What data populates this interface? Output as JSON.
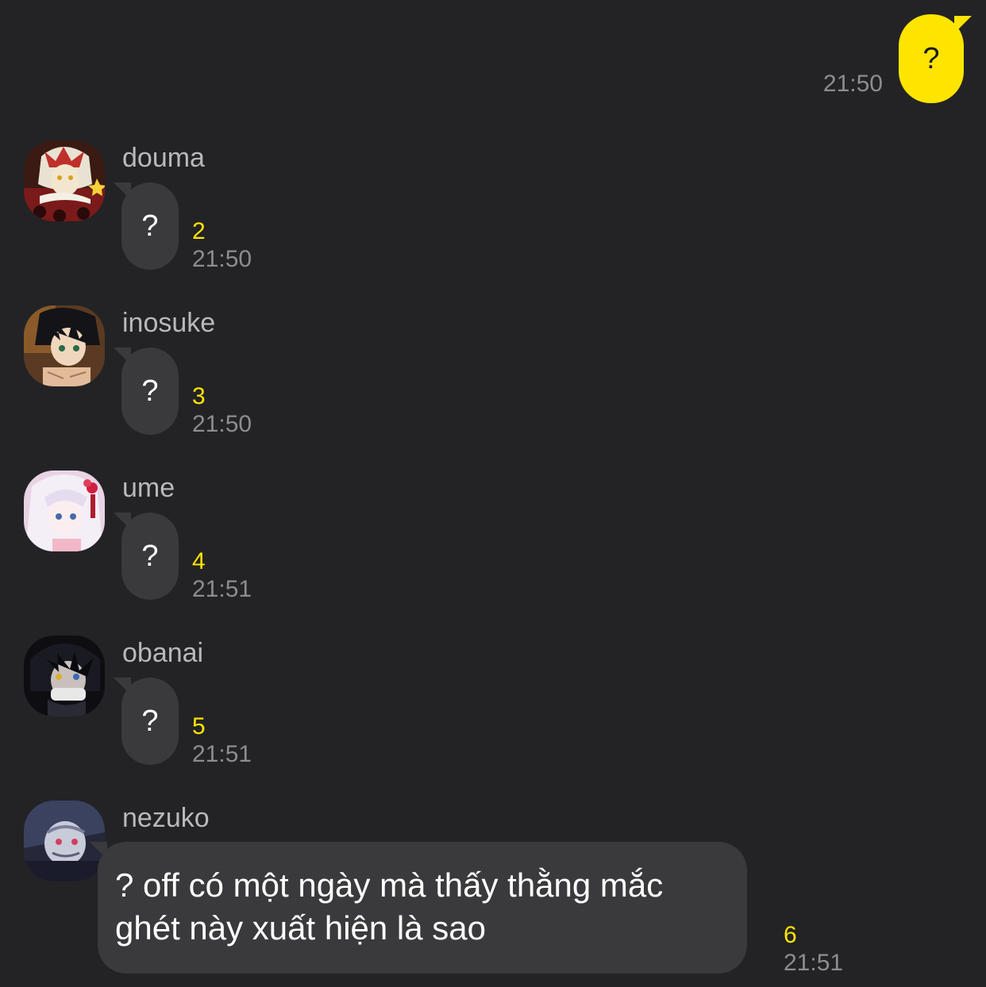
{
  "theme": {
    "background": "#232325",
    "outgoing_bubble": "#fee500",
    "incoming_bubble": "#3a3a3c",
    "unread_color": "#fee500",
    "time_color": "#8d8d90"
  },
  "outgoing": [
    {
      "text": "?",
      "time": "21:50"
    }
  ],
  "messages": [
    {
      "sender": "douma",
      "avatar": "douma-avatar",
      "text": "?",
      "unread": "2",
      "time": "21:50"
    },
    {
      "sender": "inosuke",
      "avatar": "inosuke-avatar",
      "text": "?",
      "unread": "3",
      "time": "21:50"
    },
    {
      "sender": "ume",
      "avatar": "ume-avatar",
      "text": "?",
      "unread": "4",
      "time": "21:51"
    },
    {
      "sender": "obanai",
      "avatar": "obanai-avatar",
      "text": "?",
      "unread": "5",
      "time": "21:51"
    },
    {
      "sender": "nezuko",
      "avatar": "nezuko-avatar",
      "text_line1": "? off có một ngày mà thấy thằng mắc",
      "text_line2": "ghét này xuất hiện là sao",
      "unread": "6",
      "time": "21:51"
    }
  ]
}
